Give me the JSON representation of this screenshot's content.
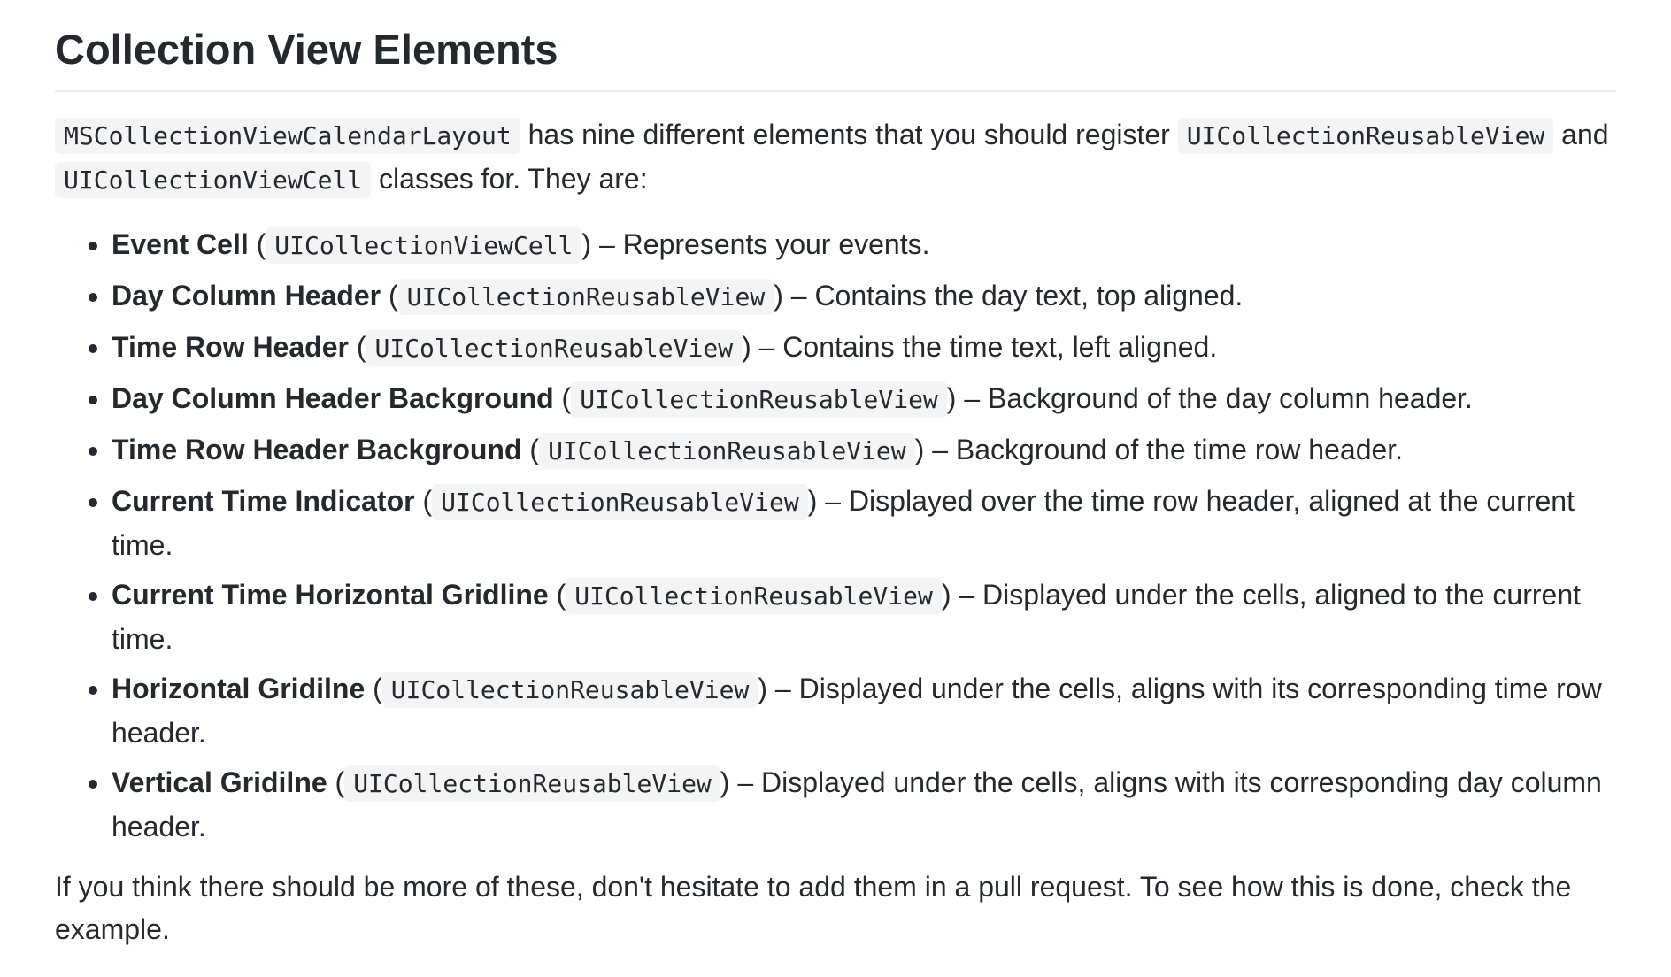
{
  "heading": "Collection View Elements",
  "intro": {
    "code1": "MSCollectionViewCalendarLayout",
    "text1": " has nine different elements that you should register ",
    "code2": "UICollectionReusableView",
    "text2": " and ",
    "code3": "UICollectionViewCell",
    "text3": " classes for. They are:"
  },
  "elements": [
    {
      "name": "Event Cell",
      "cls": "UICollectionViewCell",
      "desc": "Represents your events."
    },
    {
      "name": "Day Column Header",
      "cls": "UICollectionReusableView",
      "desc": "Contains the day text, top aligned."
    },
    {
      "name": "Time Row Header",
      "cls": "UICollectionReusableView",
      "desc": "Contains the time text, left aligned."
    },
    {
      "name": "Day Column Header Background",
      "cls": "UICollectionReusableView",
      "desc": "Background of the day column header."
    },
    {
      "name": "Time Row Header Background",
      "cls": "UICollectionReusableView",
      "desc": "Background of the time row header."
    },
    {
      "name": "Current Time Indicator",
      "cls": "UICollectionReusableView",
      "desc": "Displayed over the time row header, aligned at the current time."
    },
    {
      "name": "Current Time Horizontal Gridline",
      "cls": "UICollectionReusableView",
      "desc": "Displayed under the cells, aligned to the current time."
    },
    {
      "name": "Horizontal Gridilne",
      "cls": "UICollectionReusableView",
      "desc": "Displayed under the cells, aligns with its corresponding time row header."
    },
    {
      "name": "Vertical Gridilne",
      "cls": "UICollectionReusableView",
      "desc": "Displayed under the cells, aligns with its corresponding day column header."
    }
  ],
  "separators": {
    "open": " (",
    "close": ")",
    "dash": " – "
  },
  "closing": "If you think there should be more of these, don't hesitate to add them in a pull request. To see how this is done, check the example."
}
